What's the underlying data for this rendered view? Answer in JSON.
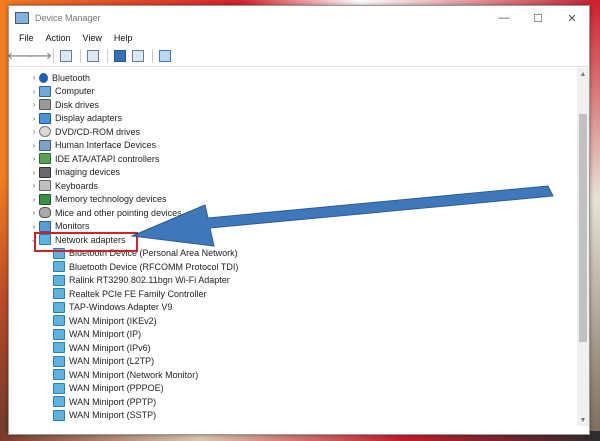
{
  "window": {
    "title": "Device Manager",
    "controls": {
      "minimize": "—",
      "maximize": "☐",
      "close": "✕"
    }
  },
  "menu": [
    "File",
    "Action",
    "View",
    "Help"
  ],
  "toolbar": {
    "back": "🡐",
    "forward": "🡒"
  },
  "tree": {
    "categories": [
      {
        "label": "Bluetooth",
        "icon": "bluetooth-icon"
      },
      {
        "label": "Computer",
        "icon": "computer-icon"
      },
      {
        "label": "Disk drives",
        "icon": "disk-drive-icon"
      },
      {
        "label": "Display adapters",
        "icon": "display-adapter-icon"
      },
      {
        "label": "DVD/CD-ROM drives",
        "icon": "dvd-icon"
      },
      {
        "label": "Human Interface Devices",
        "icon": "hid-icon"
      },
      {
        "label": "IDE ATA/ATAPI controllers",
        "icon": "ide-icon"
      },
      {
        "label": "Imaging devices",
        "icon": "camera-icon"
      },
      {
        "label": "Keyboards",
        "icon": "keyboard-icon"
      },
      {
        "label": "Memory technology devices",
        "icon": "memory-icon"
      },
      {
        "label": "Mice and other pointing devices",
        "icon": "mouse-icon"
      },
      {
        "label": "Monitors",
        "icon": "monitor-icon"
      },
      {
        "label": "Network adapters",
        "icon": "network-adapter-icon",
        "expanded": true
      }
    ],
    "network_adapters": [
      "Bluetooth Device (Personal Area Network)",
      "Bluetooth Device (RFCOMM Protocol TDI)",
      "Ralink RT3290 802.11bgn Wi-Fi Adapter",
      "Realtek PCIe FE Family Controller",
      "TAP-Windows Adapter V9",
      "WAN Miniport (IKEv2)",
      "WAN Miniport (IP)",
      "WAN Miniport (IPv6)",
      "WAN Miniport (L2TP)",
      "WAN Miniport (Network Monitor)",
      "WAN Miniport (PPPOE)",
      "WAN Miniport (PPTP)",
      "WAN Miniport (SSTP)"
    ]
  },
  "annotation": {
    "highlight_color": "#d3202a",
    "arrow_color": "#2f6db5"
  }
}
